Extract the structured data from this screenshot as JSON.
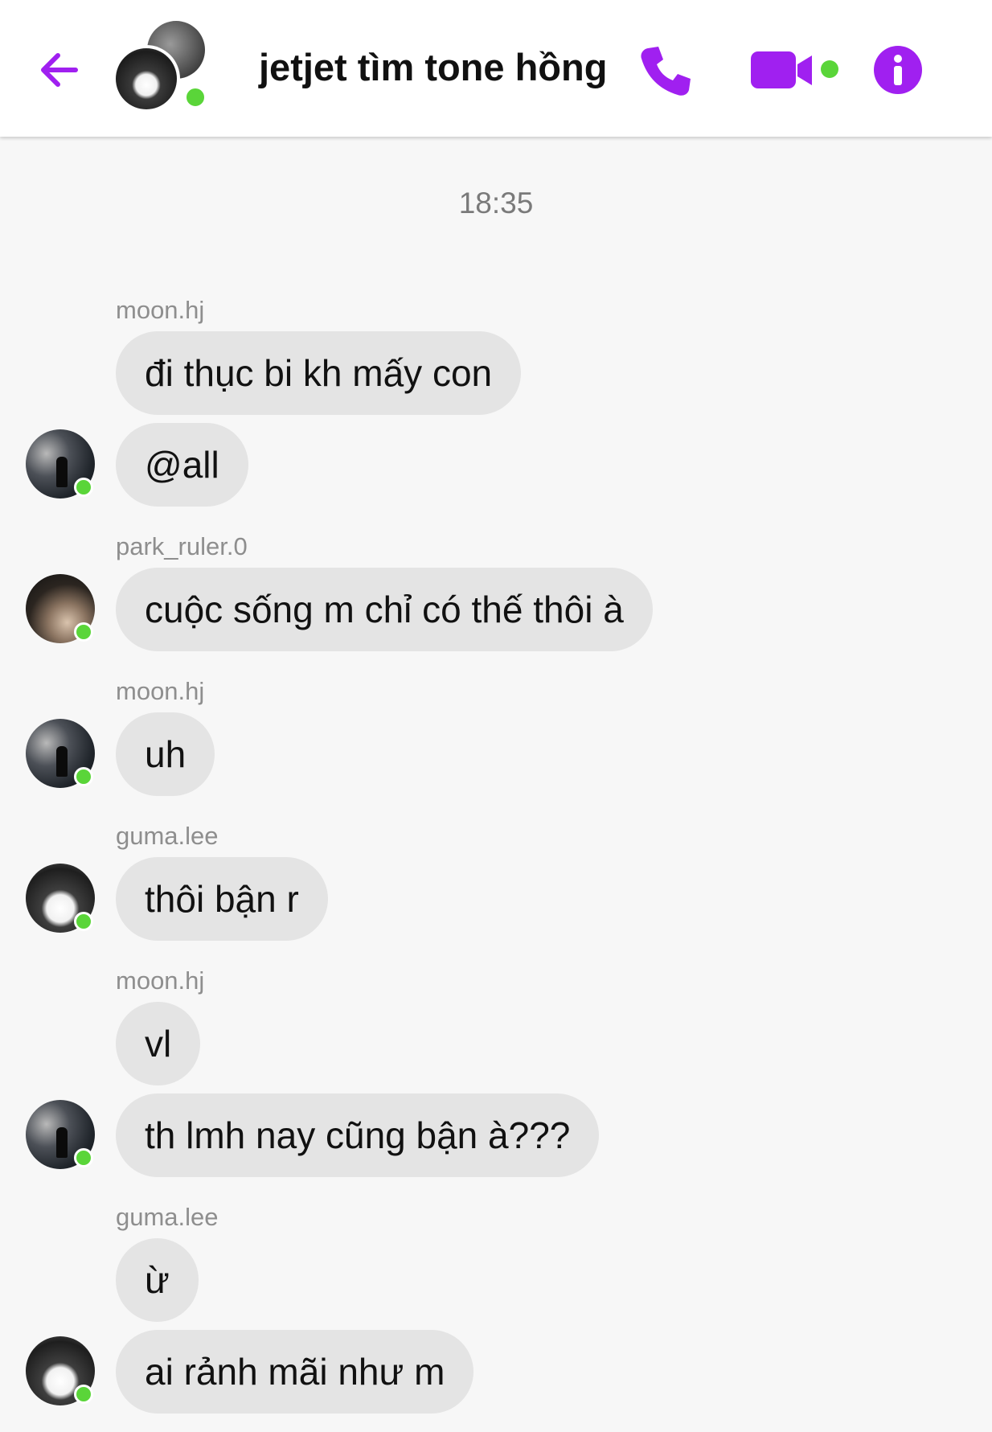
{
  "header": {
    "title": "jetjet tìm tone hồng",
    "accent_color": "#a020f0",
    "online_color": "#5ad539",
    "icons": [
      "back-arrow-icon",
      "phone-icon",
      "video-camera-icon",
      "info-icon"
    ]
  },
  "chat": {
    "timestamp": "18:35",
    "senders": [
      "moon.hj",
      "park_ruler.0",
      "moon.hj",
      "guma.lee",
      "moon.hj",
      "guma.lee"
    ],
    "messages": [
      "đi thục bi kh mấy con",
      "@all",
      "cuộc sống m chỉ có thế thôi à",
      "uh",
      "thôi bận r",
      "vl",
      "th lmh nay cũng bận à???",
      "ừ",
      "ai rảnh mãi như m"
    ]
  }
}
